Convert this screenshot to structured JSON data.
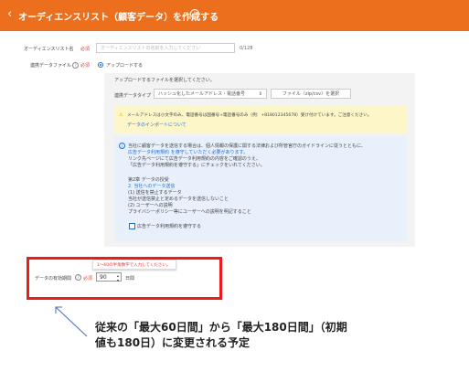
{
  "header": {
    "back_icon": "chevron-left-icon",
    "title": "オーディエンスリスト（顧客データ）を作成する",
    "info_icon": "info-icon"
  },
  "colors": {
    "header_bg": "#ec6f1d",
    "required": "#e53935",
    "highlight_border": "#ec1c1c",
    "link": "#1e6fd9"
  },
  "form": {
    "name_field": {
      "label": "オーディエンスリスト名",
      "required": "必須",
      "placeholder": "オーディエンスリストの名前を入力してください",
      "counter": "0/128"
    },
    "customer_data_file": {
      "label": "連携データファイル",
      "required": "必須",
      "option": "アップロードする",
      "panel": {
        "instruction": "アップロードするファイルを選択してください。",
        "data_type_label": "連携データタイプ",
        "data_type_value": "ハッシュ化したメールアドレス・電話番号",
        "file_button": "ファイル（zip/csv）を選択",
        "warning": "メールアドレスは小文字のみ、電話番号は国番号+電話番号のみ（例：+818012345678）受け付けています。ご注意ください。",
        "import_link": "データのインポートについて",
        "info_lines": [
          "当社に顧客データを送信する場合は、個人情報の保護に関する法律および所管官庁のガイドラインに従うとともに、",
          "広告データ利用規約 を遵守していただく必要があります。",
          "リンク先ページにて広告データ利用規約の内容をご確認のうえ、",
          "「広告データ利用規約を遵守する」にチェックをいれてください。",
          "",
          "第2章 データの授受",
          "2. 当社へのデータ送信",
          "(1) 送信を禁止するデータ",
          "     当社が送信禁止と定めるデータを送信しないこと",
          "(2) ユーザーへの説明",
          "     プライバシーポリシー等にユーザーへの説明を明記すること"
        ],
        "agree_checkbox": "広告データ利用規約を遵守する"
      }
    },
    "validity": {
      "label": "データの有効期間",
      "required": "必須",
      "tooltip": "1〜60の半角数字で入力してください。",
      "value": "90",
      "unit": "日間"
    }
  },
  "annotation": {
    "line1": "従来の「最大60日間」から「最大180日間」（初期",
    "line2": "値も180日）に変更される予定"
  }
}
